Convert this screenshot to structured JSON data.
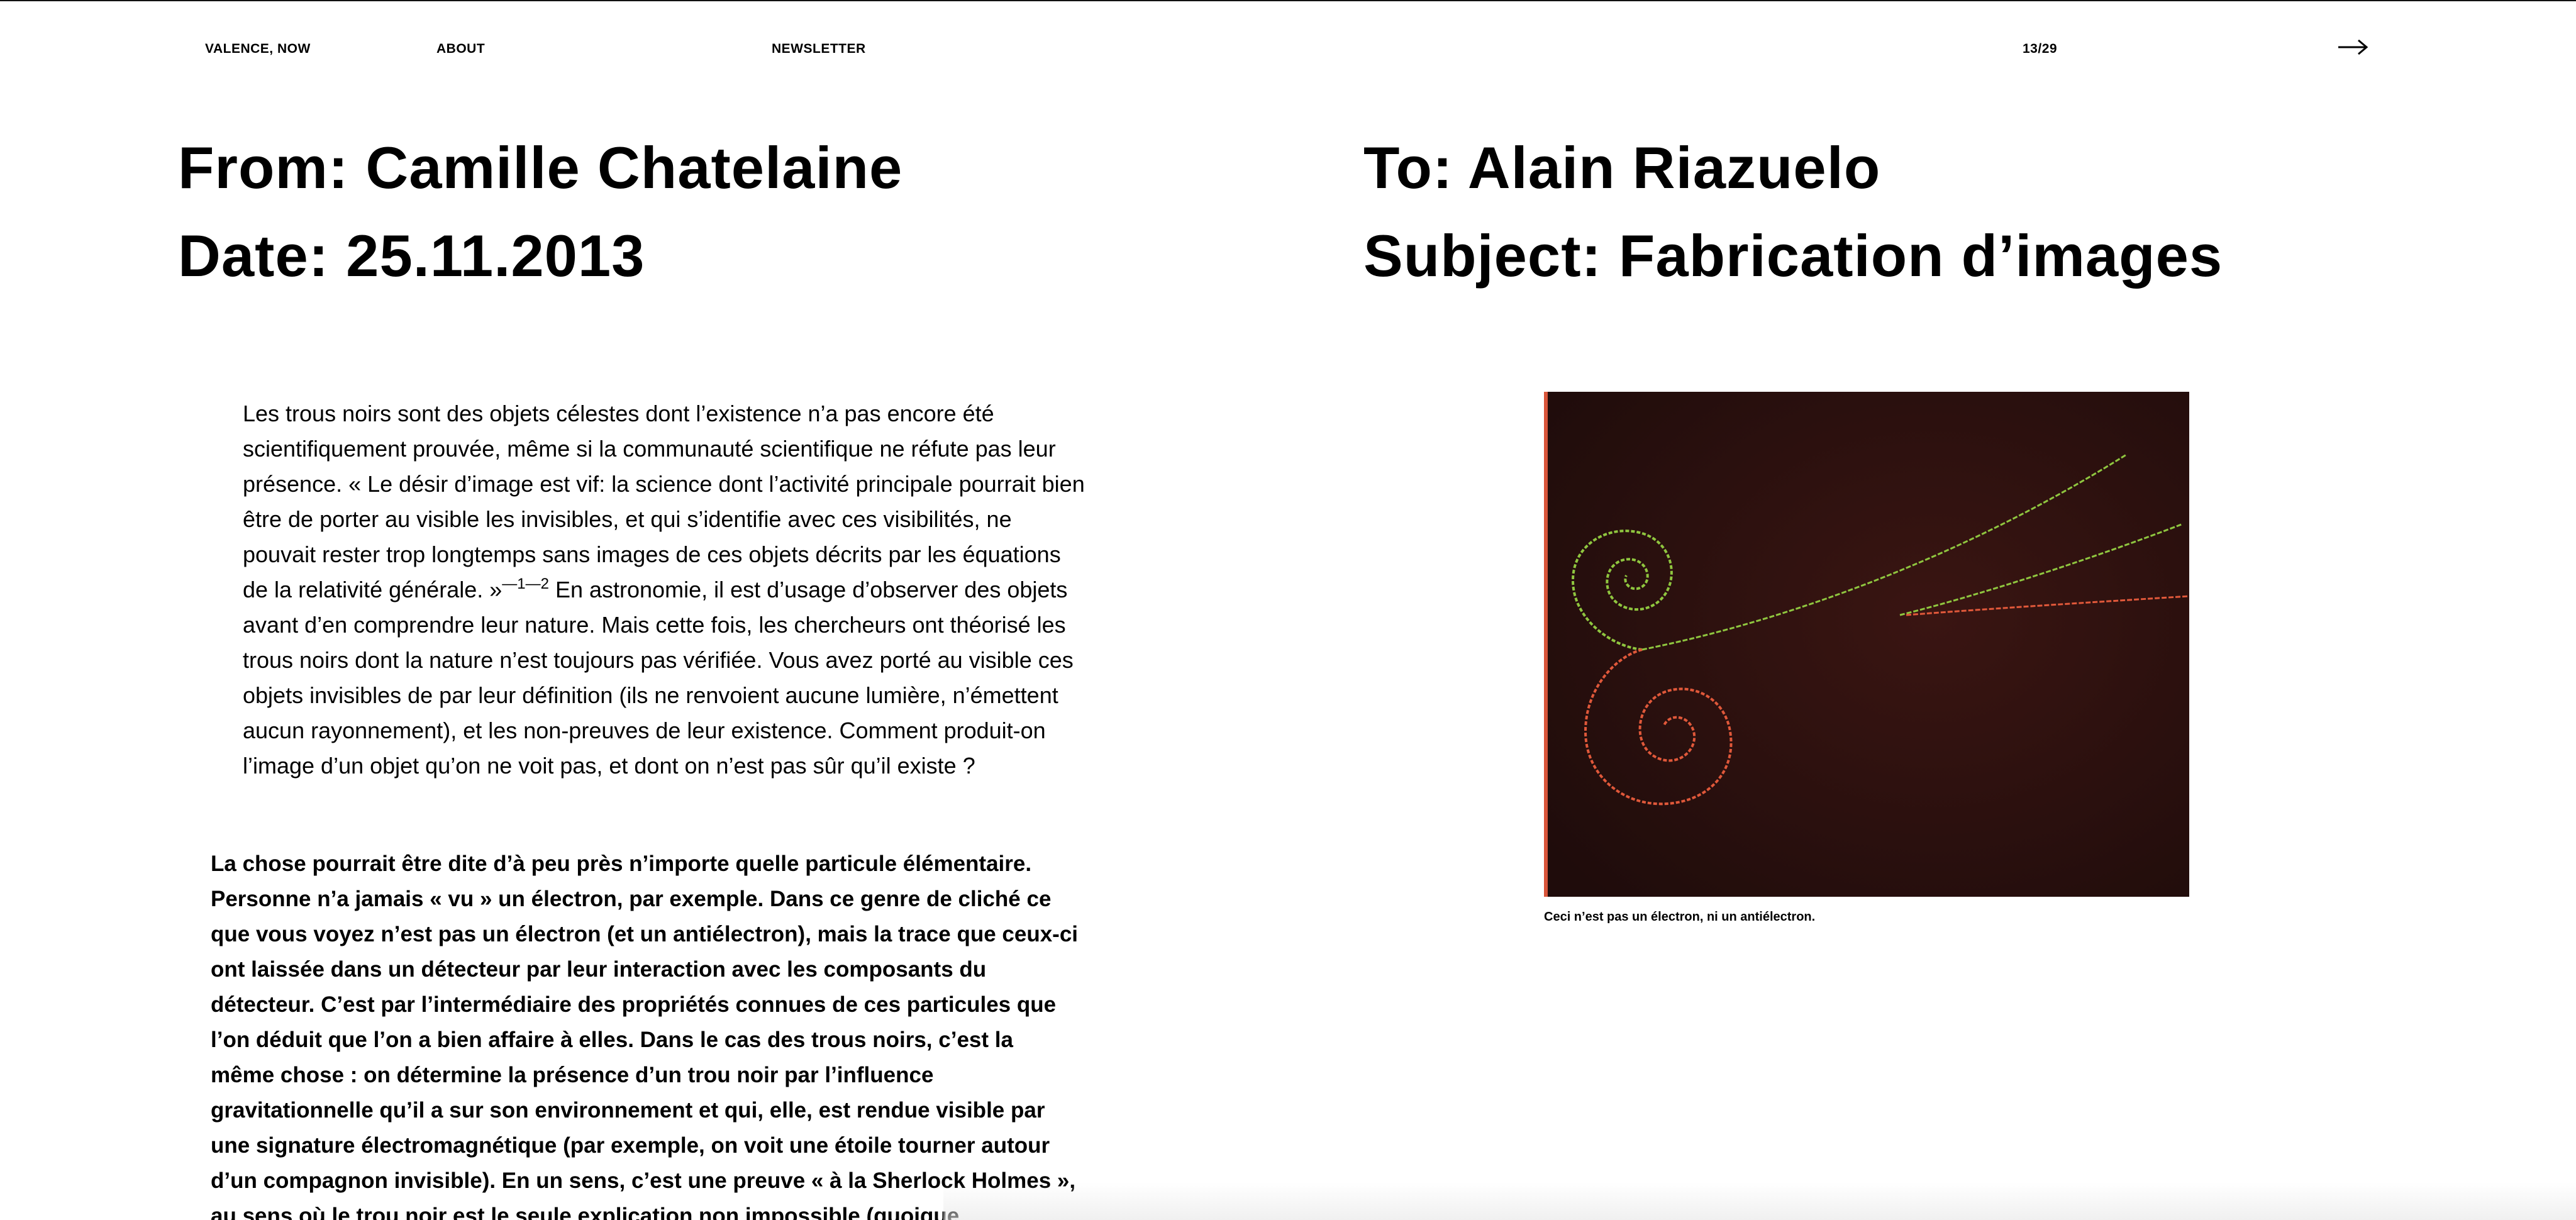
{
  "nav": {
    "home": "VALENCE, NOW",
    "about": "ABOUT",
    "newsletter": "NEWSLETTER",
    "pager": "13/29",
    "next_icon": "arrow-right-icon"
  },
  "header": {
    "from": "From: Camille Chatelaine",
    "date": "Date: 25.11.2013",
    "to": "To: Alain Riazuelo",
    "subject": "Subject: Fabrication d’images"
  },
  "quote": {
    "text_before": "Les trous noirs sont des objets célestes dont l’existence n’a pas encore été scientifiquement prouvée, même si la communauté scientifique ne réfute pas leur présence. « Le désir d’image est vif: la science dont l’activité principale pourrait bien être de porter au visible les invisibles, et qui s’identifie avec ces visibilités, ne pouvait rester trop longtemps sans images de ces objets décrits par les équations de la relativité générale. »",
    "footnote": "—1—2",
    "text_after": " En astronomie, il est d’usage d’observer des objets avant d’en comprendre leur nature. Mais cette fois, les chercheurs ont théorisé les trous noirs dont la nature n’est toujours pas vérifiée. Vous avez porté au visible ces objets invisibles de par leur définition (ils ne renvoient aucune lumière, n’émettent aucun rayonnement), et les non-preuves de leur existence. Comment produit-on l’image d’un objet qu’on ne voit pas, et dont on n’est pas sûr qu’il existe ?"
  },
  "body": {
    "text": "La chose pourrait être dite d’à peu près n’importe quelle particule élémentaire. Personne n’a jamais « vu » un électron, par exemple. Dans ce genre de cliché ce que vous voyez n’est pas un électron (et un antiélectron), mais la trace que ceux-ci ont laissée dans un détecteur par leur interaction avec les composants du détecteur. C’est par l’intermédiaire des propriétés connues de ces particules que l’on déduit que l’on a bien affaire à elles. Dans le cas des trous noirs, c’est la même chose : on détermine la présence d’un trou noir par l’influence gravitationnelle qu’il a sur son environnement et qui, elle, est rendue visible par une signature électromagnétique (par exemple, on voit une étoile tourner autour d’un compagnon invisible). En un sens, c’est une preuve « à la Sherlock Holmes », au sens où le trou noir est le seule explication non impossible (quoique"
  },
  "figure": {
    "caption": "Ceci n’est pas un électron, ni un antiélectron.",
    "colors": {
      "background": "#2a1010",
      "green_track": "#8fc63f",
      "red_track": "#e0583a"
    }
  }
}
